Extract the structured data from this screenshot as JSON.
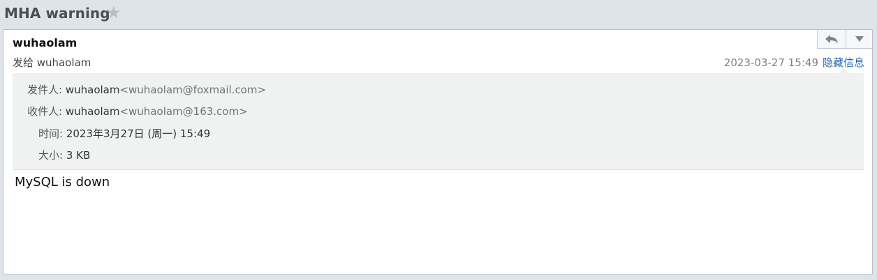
{
  "header": {
    "subject": "MHA warning",
    "star_icon": "star-icon"
  },
  "mail": {
    "sender_name": "wuhaolam",
    "to_summary": "发给 wuhaolam",
    "datetime_short": "2023-03-27 15:49",
    "hide_info_label": "隐藏信息",
    "actions": {
      "reply_icon": "reply-icon",
      "more_icon": "chevron-down-icon"
    },
    "details": {
      "from_label": "发件人:",
      "from_name": "wuhaolam",
      "from_addr": "<wuhaolam@foxmail.com>",
      "to_label": "收件人:",
      "to_name": "wuhaolam",
      "to_addr": "<wuhaolam@163.com>",
      "time_label": "时间:",
      "time_value": "2023年3月27日 (周一) 15:49",
      "size_label": "大小:",
      "size_value": "3 KB"
    },
    "body": "MySQL is down"
  },
  "colors": {
    "link": "#2e6aa8",
    "details_bg": "#eff2f1",
    "page_bg": "#dfe4ea"
  }
}
